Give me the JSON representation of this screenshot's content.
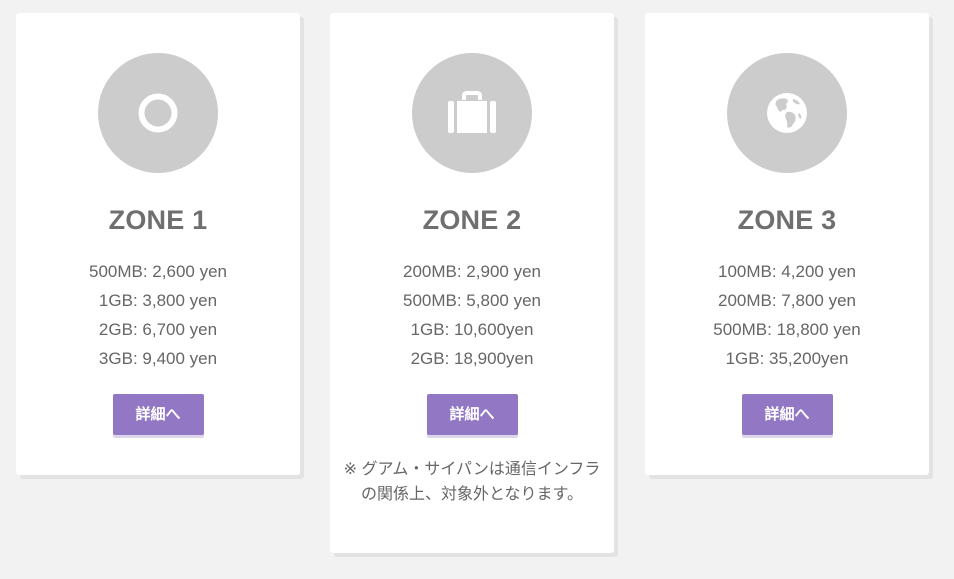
{
  "zones": [
    {
      "title": "ZONE 1",
      "icon": "circle-icon",
      "prices": [
        "500MB: 2,600 yen",
        "1GB: 3,800 yen",
        "2GB: 6,700 yen",
        "3GB: 9,400 yen"
      ],
      "button_label": "詳細へ"
    },
    {
      "title": "ZONE 2",
      "icon": "suitcase-icon",
      "prices": [
        "200MB: 2,900 yen",
        "500MB: 5,800 yen",
        "1GB: 10,600yen",
        "2GB: 18,900yen"
      ],
      "button_label": "詳細へ",
      "note": "※ グアム・サイパンは通信インフラの関係上、対象外となります。"
    },
    {
      "title": "ZONE 3",
      "icon": "globe-icon",
      "prices": [
        "100MB: 4,200 yen",
        "200MB: 7,800 yen",
        "500MB: 18,800 yen",
        "1GB: 35,200yen"
      ],
      "button_label": "詳細へ"
    }
  ],
  "colors": {
    "page_background": "#f2f2f2",
    "card_background": "#ffffff",
    "icon_circle": "#cccccc",
    "title_text": "#6f6f6f",
    "body_text": "#666666",
    "button_background": "#9277c4",
    "button_text": "#ffffff"
  }
}
